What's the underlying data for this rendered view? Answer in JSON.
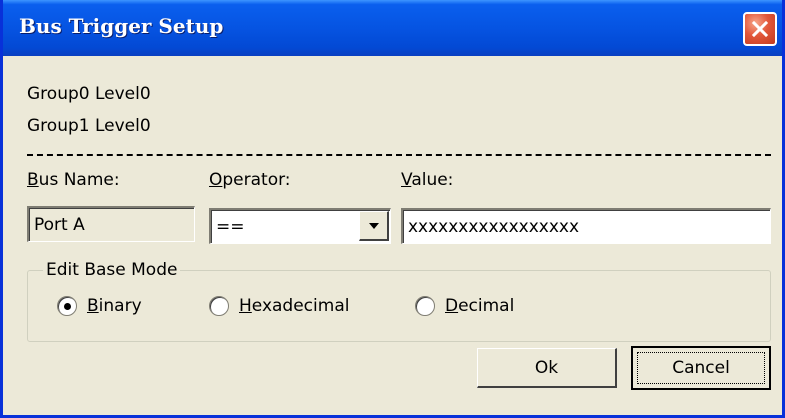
{
  "window": {
    "title": "Bus Trigger Setup"
  },
  "info": {
    "line1": "Group0 Level0",
    "line2": "Group1 Level0"
  },
  "labels": {
    "bus_name_first": "B",
    "bus_name_rest": "us Name:",
    "operator_first": "O",
    "operator_rest": "perator:",
    "value_first": "V",
    "value_rest": "alue:"
  },
  "fields": {
    "bus_name": "Port A",
    "operator": "==",
    "value": "xxxxxxxxxxxxxxxxx"
  },
  "base_mode": {
    "legend": "Edit Base Mode",
    "options": [
      {
        "first": "B",
        "rest": "inary",
        "selected": true
      },
      {
        "first": "H",
        "rest": "exadecimal",
        "selected": false
      },
      {
        "first": "D",
        "rest": "ecimal",
        "selected": false
      }
    ]
  },
  "buttons": {
    "ok": "Ok",
    "cancel": "Cancel"
  },
  "colors": {
    "title_blue": "#0654e2",
    "dialog_bg": "#ece9d8",
    "close_red": "#e2573a"
  },
  "icons": {
    "close": "close-icon",
    "dropdown": "chevron-down-icon"
  }
}
